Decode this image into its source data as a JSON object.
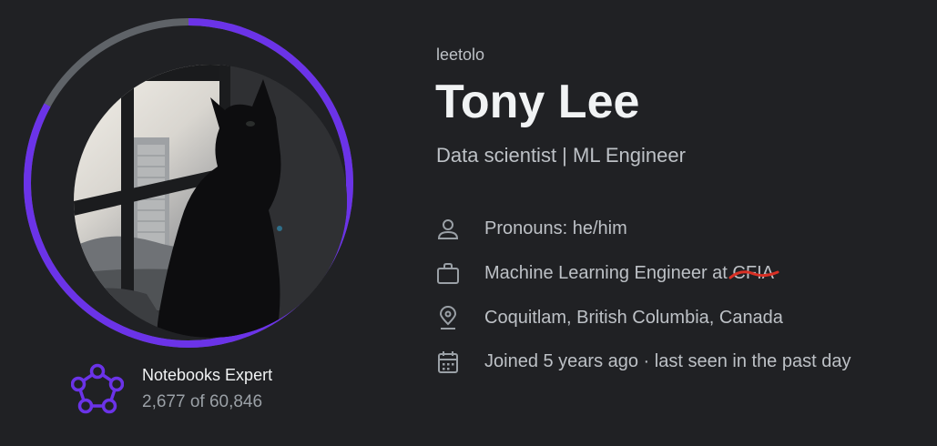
{
  "profile": {
    "username": "leetolo",
    "display_name": "Tony Lee",
    "bio": "Data scientist | ML Engineer"
  },
  "tier": {
    "name": "Notebooks Expert",
    "progress_text": "2,677 of 60,846",
    "progress_fraction": 0.83,
    "accent_color": "#6b33e8",
    "track_color": "#5f6368"
  },
  "details": {
    "pronouns": "Pronouns: he/him",
    "occupation_prefix": "Machine Learning Engineer at ",
    "occupation_org": "CFIA",
    "location": "Coquitlam, British Columbia, Canada",
    "joined": "Joined 5 years ago · last seen in the past day"
  },
  "icons": {
    "pronouns": "person-icon",
    "occupation": "briefcase-icon",
    "location": "location-pin-icon",
    "joined": "calendar-icon",
    "tier": "notebooks-expert-tier-icon"
  },
  "colors": {
    "background": "#202124",
    "accent": "#6b33e8",
    "annotation_red": "#d93025"
  }
}
